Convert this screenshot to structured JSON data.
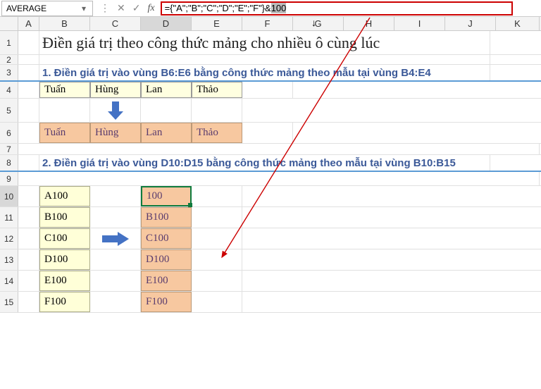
{
  "nameBox": "AVERAGE",
  "formulaParts": {
    "prefix": "={\"A\";\"B\";\"C\";\"D\";\"E\";\"F\"}&",
    "selected": "100"
  },
  "columns": [
    "A",
    "B",
    "C",
    "D",
    "E",
    "F",
    "G",
    "H",
    "I",
    "J",
    "K"
  ],
  "rows": [
    "1",
    "2",
    "3",
    "4",
    "5",
    "6",
    "7",
    "8",
    "9",
    "10",
    "11",
    "12",
    "13",
    "14",
    "15"
  ],
  "title": "Điền giá trị theo công thức mảng cho nhiều ô cùng lúc",
  "section1": "1. Điền giá trị vào vùng B6:E6 bằng công thức mảng theo mẫu tại vùng B4:E4",
  "section2": "2. Điền giá trị vào vùng D10:D15 bằng công thức mảng theo mẫu tại vùng B10:B15",
  "row4": {
    "B": "Tuấn",
    "C": "Hùng",
    "D": "Lan",
    "E": "Thảo"
  },
  "row6": {
    "B": "Tuấn",
    "C": "Hùng",
    "D": "Lan",
    "E": "Thảo"
  },
  "colB": {
    "r10": "A100",
    "r11": "B100",
    "r12": "C100",
    "r13": "D100",
    "r14": "E100",
    "r15": "F100"
  },
  "colD": {
    "r10": "100",
    "r11": "B100",
    "r12": "C100",
    "r13": "D100",
    "r14": "E100",
    "r15": "F100"
  }
}
